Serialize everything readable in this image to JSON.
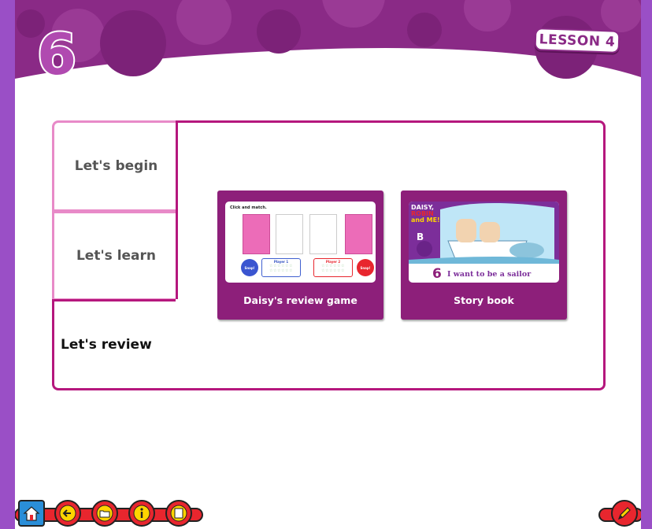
{
  "header": {
    "unit_number": "6",
    "lesson_label": "LESSON 4"
  },
  "tabs": [
    {
      "label": "Let's begin"
    },
    {
      "label": "Let's learn"
    },
    {
      "label": "Let's review",
      "active": true
    }
  ],
  "cards": [
    {
      "label": "Daisy's review game",
      "thumbnail": {
        "instruction": "Click and match.",
        "snap_label": "Snap!",
        "player1": "Player 1",
        "player2": "Player 2",
        "stars": "☆☆☆☆☆☆"
      }
    },
    {
      "label": "Story book",
      "thumbnail": {
        "logo_line1": "DAISY,",
        "logo_line2": "ROBIN",
        "logo_line3": "and ME!",
        "level": "B",
        "number": "6",
        "title": "I want to be a sailor"
      }
    }
  ],
  "footer": {
    "left_icons": [
      "home-icon",
      "back-arrow-icon",
      "folder-icon",
      "info-icon",
      "notes-icon"
    ],
    "right_icons": [
      "pencil-icon"
    ]
  },
  "colors": {
    "background": "#9a4fc6",
    "header": "#8a2a86",
    "accent": "#b5177d",
    "tab_border": "#e88ac8",
    "card": "#8d1f7a",
    "footer_button": "#e8262e"
  }
}
